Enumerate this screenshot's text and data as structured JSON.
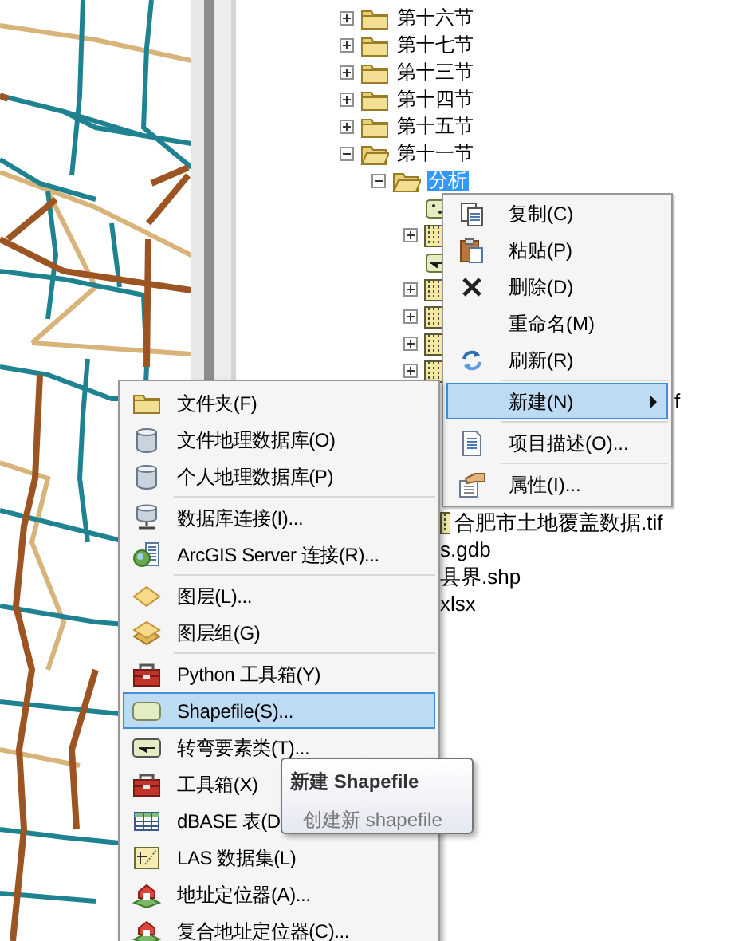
{
  "tree": [
    {
      "label": "第十六节",
      "kind": "folder",
      "expanded": false,
      "selected": false
    },
    {
      "label": "第十七节",
      "kind": "folder",
      "expanded": false,
      "selected": false
    },
    {
      "label": "第十三节",
      "kind": "folder",
      "expanded": false,
      "selected": false
    },
    {
      "label": "第十四节",
      "kind": "folder",
      "expanded": false,
      "selected": false
    },
    {
      "label": "第十五节",
      "kind": "folder",
      "expanded": false,
      "selected": false
    },
    {
      "label": "第十一节",
      "kind": "folder",
      "expanded": true,
      "selected": false,
      "children": [
        {
          "label": "分析",
          "kind": "folder",
          "expanded": true,
          "selected": true,
          "children": [
            {
              "kind": "point"
            },
            {
              "kind": "raster",
              "expanded": false
            },
            {
              "kind": "line"
            },
            {
              "kind": "raster",
              "expanded": false
            },
            {
              "kind": "raster",
              "expanded": false
            },
            {
              "kind": "raster",
              "expanded": false
            },
            {
              "kind": "raster",
              "expanded": false
            }
          ]
        }
      ]
    }
  ],
  "tree_fragments": [
    {
      "label": "f"
    },
    {
      "label": "合肥市土地覆盖数据.tif",
      "kind": "raster"
    },
    {
      "label": "s.gdb"
    },
    {
      "label": "县界.shp"
    },
    {
      "label": "xlsx"
    }
  ],
  "context_menu": {
    "items": [
      {
        "kind": "copy",
        "label": "复制(C)",
        "selected": false
      },
      {
        "kind": "paste",
        "label": "粘贴(P)",
        "selected": false
      },
      {
        "kind": "delete",
        "label": "删除(D)",
        "selected": false
      },
      {
        "kind": "plain",
        "label": "重命名(M)",
        "selected": false
      },
      {
        "kind": "refresh",
        "label": "刷新(R)",
        "selected": false
      },
      {
        "kind": "separator"
      },
      {
        "kind": "plain",
        "label": "新建(N)",
        "selected": true,
        "submenu": true
      },
      {
        "kind": "separator"
      },
      {
        "kind": "document",
        "label": "项目描述(O)...",
        "selected": false
      },
      {
        "kind": "separator"
      },
      {
        "kind": "properties",
        "label": "属性(I)...",
        "selected": false
      }
    ]
  },
  "new_submenu": {
    "items": [
      {
        "kind": "folder",
        "label": "文件夹(F)",
        "selected": false
      },
      {
        "kind": "database",
        "label": "文件地理数据库(O)",
        "selected": false
      },
      {
        "kind": "database",
        "label": "个人地理数据库(P)",
        "selected": false
      },
      {
        "kind": "separator"
      },
      {
        "kind": "server",
        "label": "数据库连接(I)...",
        "selected": false
      },
      {
        "kind": "connection",
        "label": "ArcGIS Server 连接(R)...",
        "selected": false
      },
      {
        "kind": "separator"
      },
      {
        "kind": "layer",
        "label": "图层(L)...",
        "selected": false
      },
      {
        "kind": "group",
        "label": "图层组(G)",
        "selected": false
      },
      {
        "kind": "separator"
      },
      {
        "kind": "toolbox",
        "label": "Python 工具箱(Y)",
        "selected": false
      },
      {
        "kind": "shapefile",
        "label": "Shapefile(S)...",
        "selected": true
      },
      {
        "kind": "turn",
        "label": "转弯要素类(T)...",
        "selected": false
      },
      {
        "kind": "toolbox",
        "label": "工具箱(X)",
        "selected": false
      },
      {
        "kind": "table",
        "label": "dBASE 表(D",
        "selected": false
      },
      {
        "kind": "las",
        "label": "LAS 数据集(L)",
        "selected": false
      },
      {
        "kind": "locator",
        "label": "地址定位器(A)...",
        "selected": false
      },
      {
        "kind": "locator",
        "label": "复合地址定位器(C)...",
        "selected": false
      }
    ]
  },
  "tooltip": {
    "title": "新建 Shapefile",
    "description": "创建新 shapefile"
  }
}
